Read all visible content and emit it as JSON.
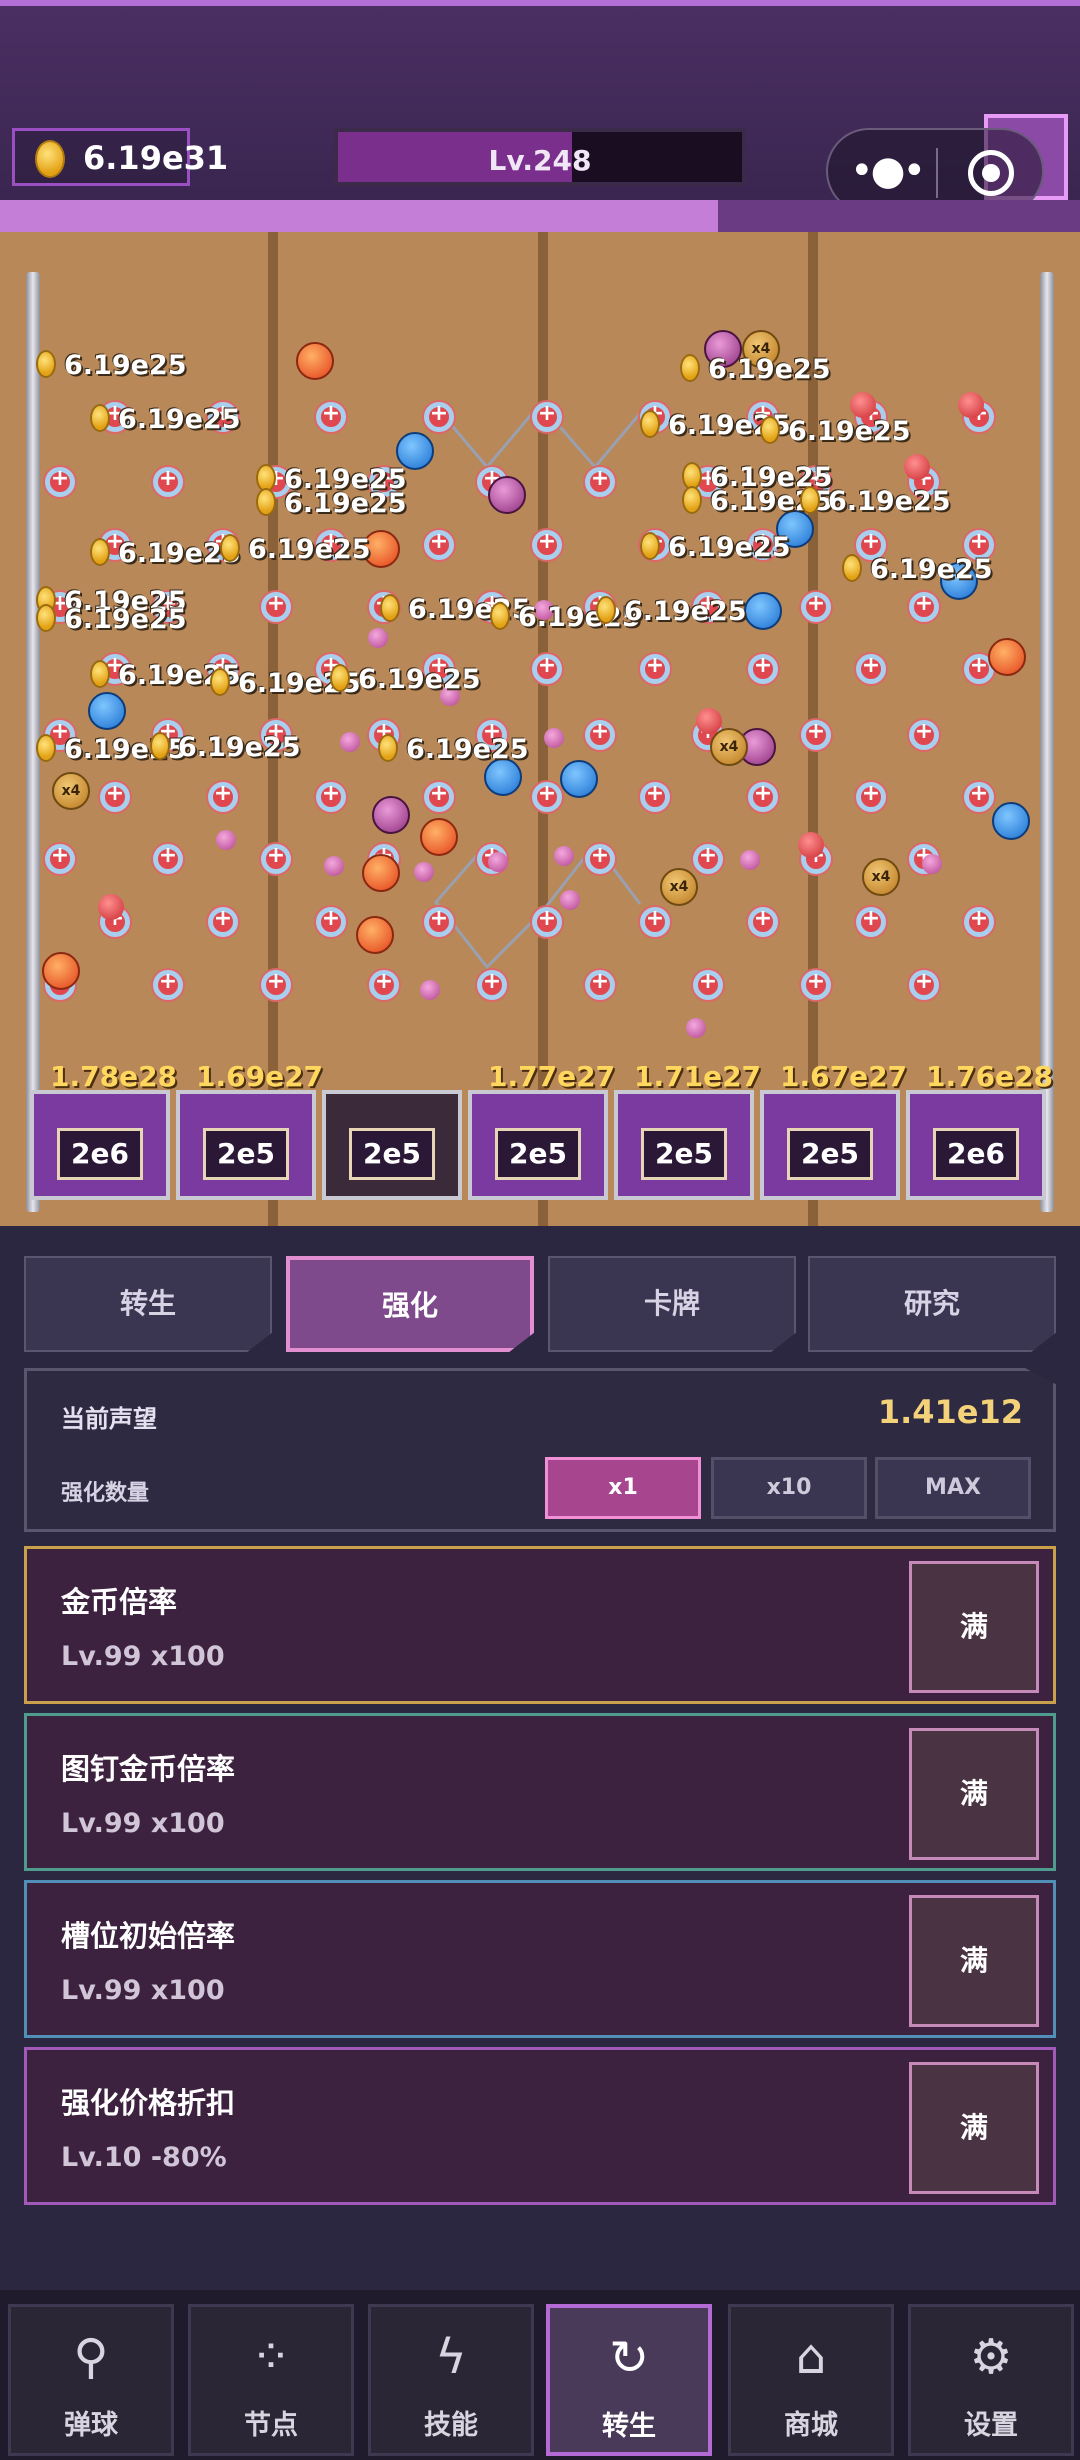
{
  "header": {
    "coins": "6.19e31",
    "level": "Lv.248",
    "level_progress": 0.58,
    "xp_progress": 0.665,
    "more_icon": "more-dots-icon",
    "close_icon": "target-close-icon",
    "pause_icon": "pause-icon"
  },
  "board": {
    "float_value": "6.19e25",
    "slots": [
      {
        "label": "2e6",
        "total": "1.78e28"
      },
      {
        "label": "2e5",
        "total": "1.69e27"
      },
      {
        "label": "2e5",
        "total": ""
      },
      {
        "label": "2e5",
        "total": "1.77e27"
      },
      {
        "label": "2e5",
        "total": "1.71e27"
      },
      {
        "label": "2e5",
        "total": "1.67e27"
      },
      {
        "label": "2e6",
        "total": "1.76e28"
      }
    ],
    "ball_tag": "x4"
  },
  "tabs": [
    {
      "label": "转生",
      "active": false
    },
    {
      "label": "强化",
      "active": true
    },
    {
      "label": "卡牌",
      "active": false
    },
    {
      "label": "研究",
      "active": false
    }
  ],
  "prestige": {
    "label": "当前声望",
    "value": "1.41e12",
    "qty_label": "强化数量",
    "qty_options": [
      "x1",
      "x10",
      "MAX"
    ],
    "qty_selected": "x1"
  },
  "upgrades": [
    {
      "name": "金币倍率",
      "level": "Lv.99 x100",
      "button": "满",
      "border": "#c9a14a"
    },
    {
      "name": "图钉金币倍率",
      "level": "Lv.99 x100",
      "button": "满",
      "border": "#4f9c8e"
    },
    {
      "name": "槽位初始倍率",
      "level": "Lv.99 x100",
      "button": "满",
      "border": "#4f8fb8"
    },
    {
      "name": "强化价格折扣",
      "level": "Lv.10 -80%",
      "button": "满",
      "border": "#a25ab8"
    }
  ],
  "nav": [
    {
      "label": "弹球",
      "icon": "pinball-icon",
      "glyph": "⚲",
      "active": false
    },
    {
      "label": "节点",
      "icon": "nodes-icon",
      "glyph": "⁘",
      "active": false
    },
    {
      "label": "技能",
      "icon": "lightning-icon",
      "glyph": "ϟ",
      "active": false
    },
    {
      "label": "转生",
      "icon": "rebirth-icon",
      "glyph": "↻",
      "active": true
    },
    {
      "label": "商城",
      "icon": "shop-bag-icon",
      "glyph": "⌂",
      "active": false
    },
    {
      "label": "设置",
      "icon": "gear-icon",
      "glyph": "⚙",
      "active": false
    }
  ]
}
